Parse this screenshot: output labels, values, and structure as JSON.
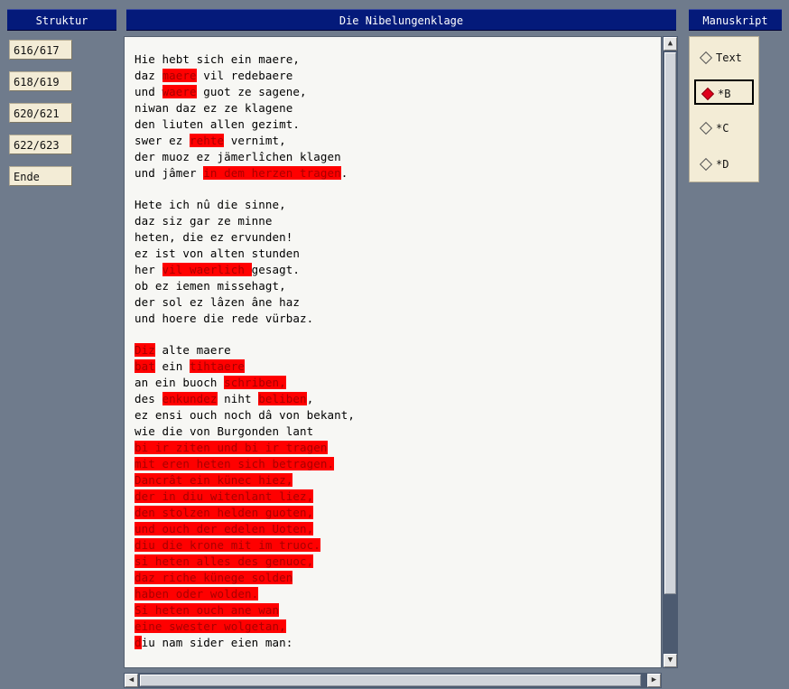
{
  "headers": {
    "struktur": "Struktur",
    "title": "Die Nibelungenklage",
    "manuskript": "Manuskript"
  },
  "struktur_items": [
    "616/617",
    "618/619",
    "620/621",
    "622/623",
    "Ende"
  ],
  "manuskript_options": [
    {
      "label": "Text",
      "selected": false
    },
    {
      "label": "*B",
      "selected": true
    },
    {
      "label": "*C",
      "selected": false
    },
    {
      "label": "*D",
      "selected": false
    }
  ],
  "colors": {
    "highlight": "#ff0000",
    "header_bg": "#041a7a",
    "window_bg": "#6f7b8c",
    "panel_bg": "#f3ecd6"
  },
  "stanzas": [
    [
      [
        {
          "t": "Hie hebt sich ein maere,"
        }
      ],
      [
        {
          "t": "daz "
        },
        {
          "t": "maere",
          "h": true
        },
        {
          "t": " vil redebaere"
        }
      ],
      [
        {
          "t": "und "
        },
        {
          "t": "waere",
          "h": true
        },
        {
          "t": " guot ze sagene,"
        }
      ],
      [
        {
          "t": "niwan daz ez ze klagene"
        }
      ],
      [
        {
          "t": "den liuten allen gezimt."
        }
      ],
      [
        {
          "t": "swer ez "
        },
        {
          "t": "rehte",
          "h": true
        },
        {
          "t": " vernimt,"
        }
      ],
      [
        {
          "t": "der muoz ez jämerlîchen klagen"
        }
      ],
      [
        {
          "t": "und jâmer "
        },
        {
          "t": "in dem herzen tragen",
          "h": true
        },
        {
          "t": "."
        }
      ]
    ],
    [
      [
        {
          "t": "Hete ich nû die sinne,"
        }
      ],
      [
        {
          "t": "daz siz gar ze minne"
        }
      ],
      [
        {
          "t": "heten, die ez ervunden!"
        }
      ],
      [
        {
          "t": "ez ist von alten stunden"
        }
      ],
      [
        {
          "t": "her "
        },
        {
          "t": "vil waerlich ",
          "h": true
        },
        {
          "t": "gesagt."
        }
      ],
      [
        {
          "t": "ob ez iemen missehagt,"
        }
      ],
      [
        {
          "t": "der sol ez lâzen âne haz"
        }
      ],
      [
        {
          "t": "und hoere die rede vürbaz."
        }
      ]
    ],
    [
      [
        {
          "t": "Diz",
          "h": true
        },
        {
          "t": " alte maere"
        }
      ],
      [
        {
          "t": "bat",
          "h": true
        },
        {
          "t": " ein "
        },
        {
          "t": "tihtaere",
          "h": true
        }
      ],
      [
        {
          "t": "an ein buoch "
        },
        {
          "t": "schriben,",
          "h": true
        }
      ],
      [
        {
          "t": "des "
        },
        {
          "t": "enkundez",
          "h": true
        },
        {
          "t": " niht "
        },
        {
          "t": "beliben",
          "h": true
        },
        {
          "t": ","
        }
      ],
      [
        {
          "t": "ez ensi ouch noch dâ von bekant,"
        }
      ],
      [
        {
          "t": "wie die von Burgonden lant"
        }
      ],
      [
        {
          "t": "bi ir ziten und bi ir tragen",
          "h": true
        }
      ],
      [
        {
          "t": "mit eren heten sich betragen.",
          "h": true
        }
      ],
      [
        {
          "t": "Dancrât ein künec hiez,",
          "h": true
        }
      ],
      [
        {
          "t": "der in diu witenlant liez,",
          "h": true
        }
      ],
      [
        {
          "t": "den stolzen helden guoten,",
          "h": true
        }
      ],
      [
        {
          "t": "und ouch der edelen Uoten,",
          "h": true
        }
      ],
      [
        {
          "t": "diu die krone mit im truoc.",
          "h": true
        }
      ],
      [
        {
          "t": "si heten alles des genuoc,",
          "h": true
        }
      ],
      [
        {
          "t": "daz riche künege solden",
          "h": true
        }
      ],
      [
        {
          "t": "haben oder wolden.",
          "h": true
        }
      ],
      [
        {
          "t": "Si heten ouch ane wan",
          "h": true
        }
      ],
      [
        {
          "t": "eine swester wolgetan,",
          "h": true
        }
      ],
      [
        {
          "t": "d",
          "h": true
        },
        {
          "t": "iu nam sider eien man:"
        }
      ]
    ]
  ]
}
